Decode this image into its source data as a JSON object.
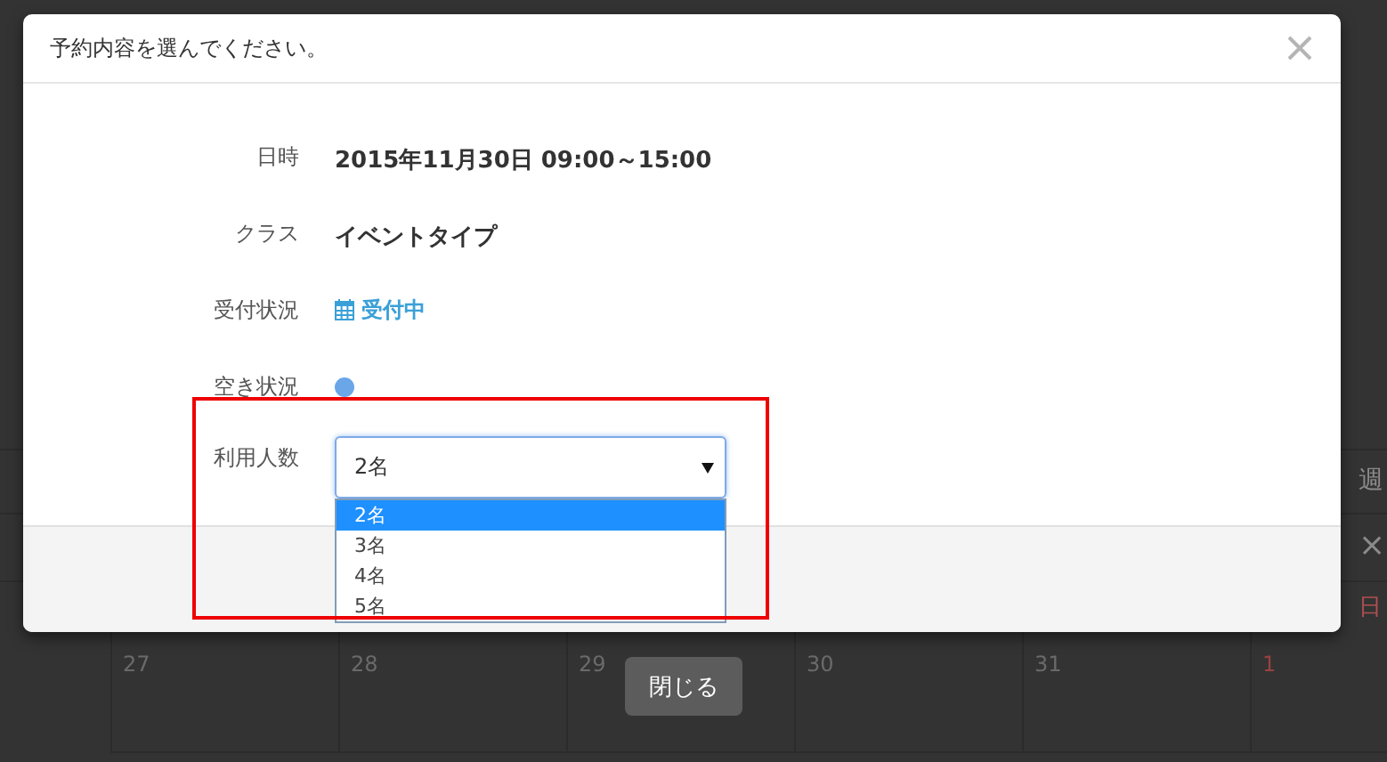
{
  "modal": {
    "title": "予約内容を選んでください。",
    "fields": [
      {
        "kind": "text",
        "label": "日時",
        "value": "2015年11月30日 09:00～15:00"
      },
      {
        "kind": "text",
        "label": "クラス",
        "value": "イベントタイプ"
      },
      {
        "kind": "status",
        "label": "受付状況",
        "value": "受付中"
      },
      {
        "kind": "dot",
        "label": "空き状況",
        "color": "#6aa6e8"
      },
      {
        "kind": "select",
        "label": "利用人数",
        "value": "2名",
        "expanded": true,
        "options": [
          {
            "label": "2名",
            "selected": true
          },
          {
            "label": "3名",
            "selected": false
          },
          {
            "label": "4名",
            "selected": false
          },
          {
            "label": "5名",
            "selected": false
          }
        ]
      }
    ]
  },
  "close_button": "閉じる",
  "calendar": {
    "week_label": "週",
    "close_mark": "×",
    "day_label": "日",
    "days": [
      {
        "label": "27",
        "holiday": false
      },
      {
        "label": "28",
        "holiday": false
      },
      {
        "label": "29",
        "holiday": false
      },
      {
        "label": "30",
        "holiday": false
      },
      {
        "label": "31",
        "holiday": false
      },
      {
        "label": "1",
        "holiday": true
      }
    ]
  }
}
